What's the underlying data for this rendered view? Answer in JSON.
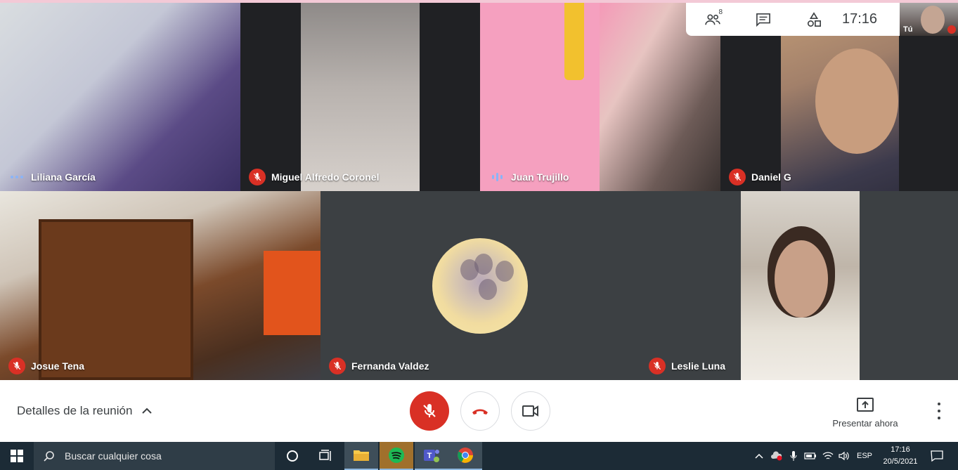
{
  "participants": [
    {
      "name": "Liliana García",
      "status": "speaking"
    },
    {
      "name": "Miguel Alfredo Coronel",
      "status": "muted"
    },
    {
      "name": "Juan Trujillo",
      "status": "audio"
    },
    {
      "name": "Daniel G",
      "status": "muted"
    },
    {
      "name": "Josue Tena",
      "status": "muted"
    },
    {
      "name": "Fernanda Valdez",
      "status": "muted"
    },
    {
      "name": "Leslie Luna",
      "status": "muted"
    }
  ],
  "topbar": {
    "people_count": "8",
    "time": "17:16",
    "self_label": "Tú",
    "icons": [
      "people-icon",
      "chat-icon",
      "activities-icon"
    ]
  },
  "bottombar": {
    "details_label": "Detalles de la reunión",
    "present_label": "Presentar ahora"
  },
  "taskbar": {
    "search_placeholder": "Buscar cualquier cosa",
    "language": "ESP",
    "clock_time": "17:16",
    "clock_date": "20/5/2021",
    "apps": [
      "cortana-icon",
      "task-view-icon",
      "file-explorer-icon",
      "spotify-icon",
      "teams-icon",
      "chrome-icon"
    ]
  },
  "colors": {
    "muted_red": "#d93025",
    "meet_dark": "#202124",
    "tile_bg": "#3c4043",
    "accent_blue": "#8ab4f8",
    "taskbar": "#1c2b36"
  }
}
